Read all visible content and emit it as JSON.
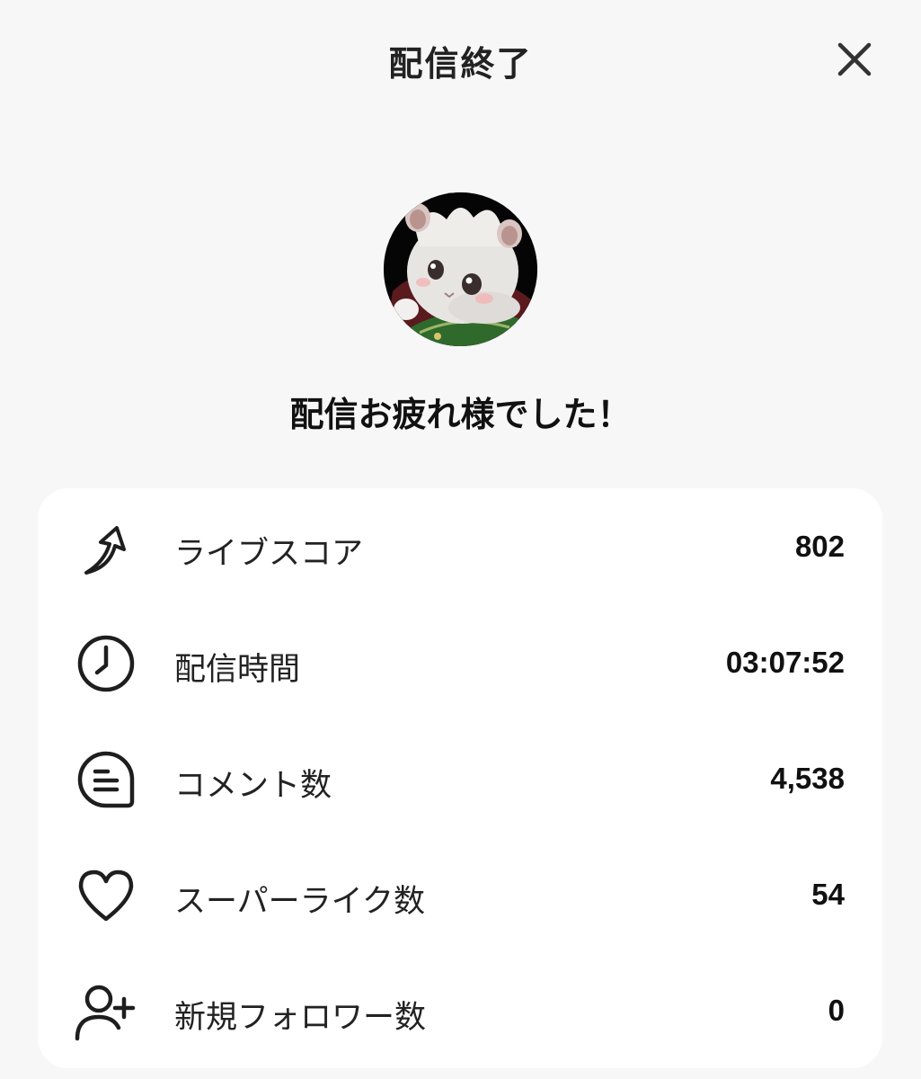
{
  "header": {
    "title": "配信終了",
    "close_icon": "close-icon"
  },
  "avatar": {
    "description": "white hamster character avatar"
  },
  "message": "配信お疲れ様でした！",
  "stats": [
    {
      "icon": "arrow-up-icon",
      "label": "ライブスコア",
      "value": "802"
    },
    {
      "icon": "clock-icon",
      "label": "配信時間",
      "value": "03:07:52"
    },
    {
      "icon": "comment-icon",
      "label": "コメント数",
      "value": "4,538"
    },
    {
      "icon": "heart-icon",
      "label": "スーパーライク数",
      "value": "54"
    },
    {
      "icon": "add-user-icon",
      "label": "新規フォロワー数",
      "value": "0"
    }
  ],
  "colors": {
    "background": "#f7f7f7",
    "card": "#ffffff",
    "text": "#1b1b1b"
  }
}
